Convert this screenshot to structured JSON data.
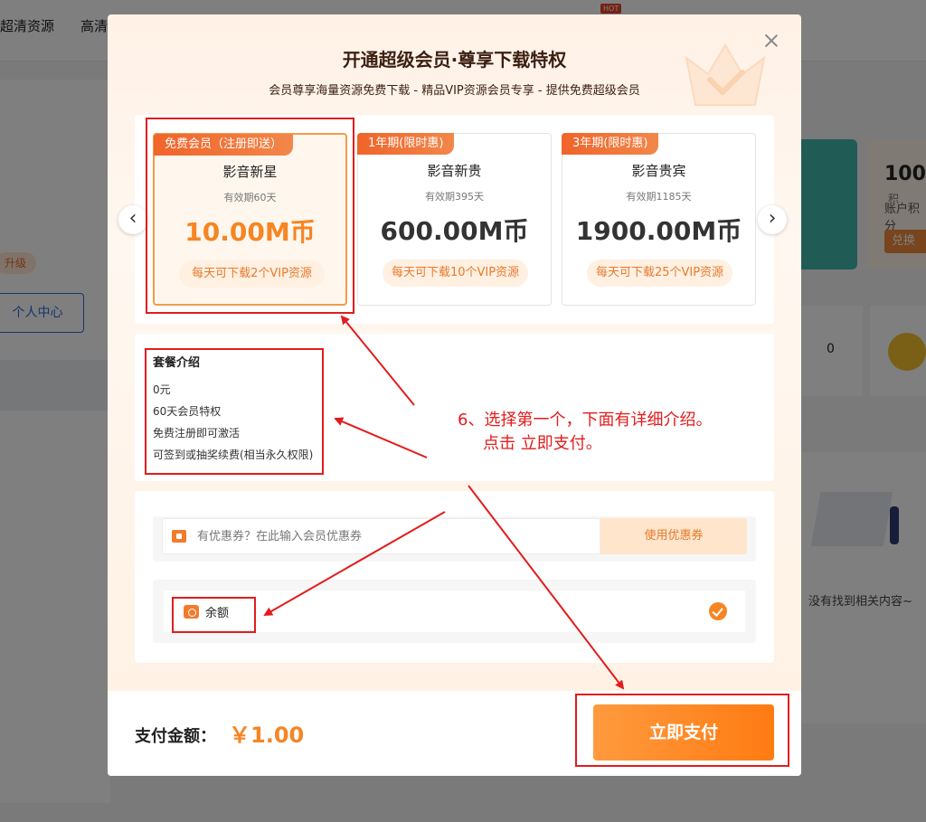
{
  "background": {
    "nav": [
      "超清资源",
      "高清"
    ],
    "hot_badge": "HOT",
    "upgrade_label": "升级",
    "personal_center": "个人中心",
    "points_value": "100",
    "points_unit": "积",
    "points_label": "账户积分",
    "exchange_label": "兑换",
    "count_value": "0",
    "empty_text": "没有找到相关内容~"
  },
  "modal": {
    "title": "开通超级会员·尊享下载特权",
    "subtitle": "会员尊享海量资源免费下载 - 精品VIP资源会员专享 - 提供免费超级会员",
    "plans": [
      {
        "tag": "免费会员（注册即送）",
        "name": "影音新星",
        "validity": "有效期60天",
        "price": "10.00M币",
        "perk": "每天可下载2个VIP资源",
        "selected": true
      },
      {
        "tag": "1年期(限时惠)",
        "name": "影音新贵",
        "validity": "有效期395天",
        "price": "600.00M币",
        "perk": "每天可下载10个VIP资源",
        "selected": false
      },
      {
        "tag": "3年期(限时惠)",
        "name": "影音贵宾",
        "validity": "有效期1185天",
        "price": "1900.00M币",
        "perk": "每天可下载25个VIP资源",
        "selected": false
      }
    ],
    "intro": {
      "title": "套餐介绍",
      "lines": [
        "0元",
        "60天会员特权",
        "免费注册即可激活",
        "可签到或抽奖续费(相当永久权限)"
      ]
    },
    "coupon": {
      "placeholder": "有优惠券？在此输入会员优惠券",
      "button": "使用优惠券"
    },
    "balance_label": "余额",
    "amount_label": "支付金额：",
    "amount_value": "￥1.00",
    "pay_button": "立即支付"
  },
  "annotation": {
    "line1": "6、选择第一个，下面有详细介绍。",
    "line2": "点击 立即支付。"
  },
  "colors": {
    "accent": "#f68523",
    "annotation": "#e21c1c",
    "tag_gradient_start": "#f0642a"
  }
}
